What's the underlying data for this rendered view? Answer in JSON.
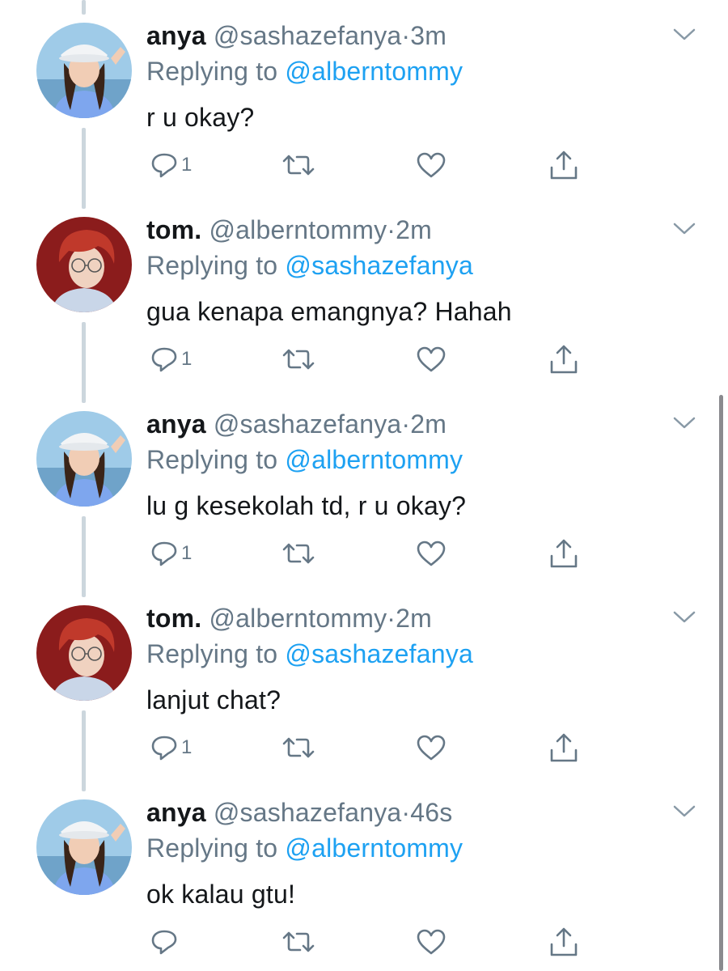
{
  "colors": {
    "link": "#1da1f2",
    "secondary_text": "#657786",
    "primary_text": "#14171a",
    "thread_line": "#ccd6dd"
  },
  "icons": [
    "reply-icon",
    "retweet-icon",
    "like-icon",
    "share-icon",
    "chevron-down-icon"
  ],
  "tweets": [
    {
      "name": "anya",
      "handle": "@sashazefanya",
      "separator": "·",
      "time": "3m",
      "replying_prefix": "Replying to ",
      "replying_to": "@alberntommy",
      "text": "r u okay?",
      "reply_count": "1"
    },
    {
      "name": "tom.",
      "handle": "@alberntommy",
      "separator": "·",
      "time": "2m",
      "replying_prefix": "Replying to ",
      "replying_to": "@sashazefanya",
      "text": "gua kenapa emangnya? Hahah",
      "reply_count": "1"
    },
    {
      "name": "anya",
      "handle": "@sashazefanya",
      "separator": "·",
      "time": "2m",
      "replying_prefix": "Replying to ",
      "replying_to": "@alberntommy",
      "text": "lu g kesekolah td, r u okay?",
      "reply_count": "1"
    },
    {
      "name": "tom.",
      "handle": "@alberntommy",
      "separator": "·",
      "time": "2m",
      "replying_prefix": "Replying to ",
      "replying_to": "@sashazefanya",
      "text": "lanjut chat?",
      "reply_count": "1"
    },
    {
      "name": "anya",
      "handle": "@sashazefanya",
      "separator": "·",
      "time": "46s",
      "replying_prefix": "Replying to ",
      "replying_to": "@alberntommy",
      "text": "ok kalau gtu!",
      "reply_count": ""
    }
  ]
}
